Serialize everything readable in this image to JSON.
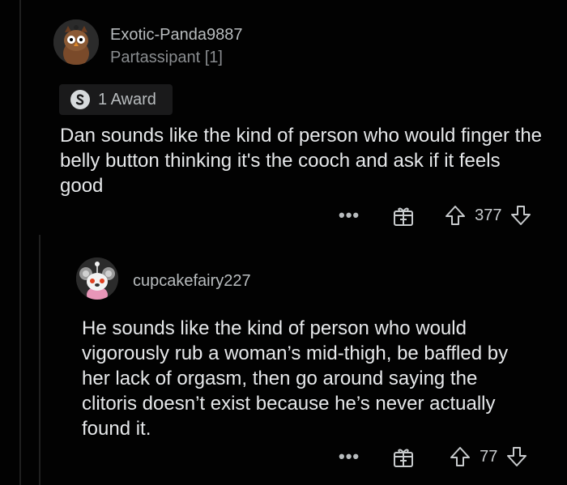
{
  "comment1": {
    "username": "Exotic-Panda9887",
    "flair": "Partassipant [1]",
    "award_label": "1 Award",
    "body": "Dan sounds like the kind of person who would finger the belly button thinking it's the cooch and ask if it feels good",
    "more_label": "•••",
    "score": "377"
  },
  "comment2": {
    "username": "cupcakefairy227",
    "body": "He sounds like the kind of person who would vigorously rub a woman’s mid-thigh, be baffled by her lack of orgasm, then go around saying the clitoris doesn’t exist because he’s never actually found it.",
    "more_label": "•••",
    "score": "77"
  },
  "icons": [
    "avatar",
    "award-icon",
    "more-icon",
    "gift-icon",
    "upvote-icon",
    "downvote-icon"
  ],
  "colors": {
    "background": "#020202",
    "text": "#e6e8ea",
    "muted": "#8a8d90",
    "thread": "#1f1f1f"
  }
}
